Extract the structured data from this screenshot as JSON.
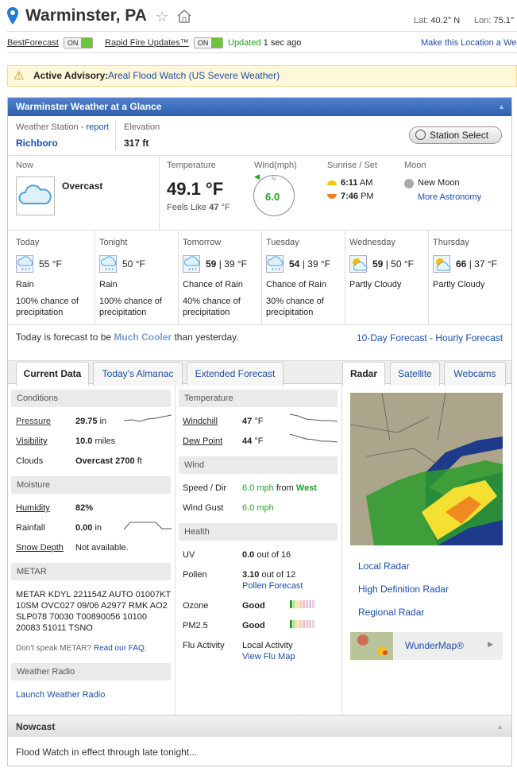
{
  "header": {
    "title": "Warminster, PA",
    "lat_label": "Lat:",
    "lat": "40.2° N",
    "lon_label": "Lon:",
    "lon": "75.1°"
  },
  "toolbar": {
    "bestforecast": "BestForecast",
    "rapidfire": "Rapid Fire Updates™",
    "on": "ON",
    "updated_label": "Updated",
    "updated_val": "1 sec ago",
    "make_location": "Make this Location a Wea"
  },
  "advisory": {
    "label": "Active Advisory:",
    "text": "Areal Flood Watch (US Severe Weather)"
  },
  "glance": {
    "title": "Warminster Weather at a Glance",
    "station_label": "Weather Station -",
    "report": "report",
    "station": "Richboro",
    "elev_label": "Elevation",
    "elev": "317 ft",
    "station_select": "Station Select"
  },
  "now": {
    "label": "Now",
    "condition": "Overcast",
    "temp_label": "Temperature",
    "temp": "49.1 °F",
    "feels_label": "Feels Like",
    "feels": "47",
    "feels_unit": "°F",
    "wind_label": "Wind(mph)",
    "wind": "6.0",
    "wind_n": "N",
    "sun_label": "Sunrise / Set",
    "sunrise": "6:11",
    "am": "AM",
    "sunset": "7:46",
    "pm": "PM",
    "moon_label": "Moon",
    "moon": "New Moon",
    "more_astro": "More Astronomy"
  },
  "forecast": [
    {
      "name": "Today",
      "temp": "55",
      "temp2": "",
      "unit": "°F",
      "cond": "Rain",
      "detail": "100% chance of precipitation"
    },
    {
      "name": "Tonight",
      "temp": "50",
      "temp2": "",
      "unit": "°F",
      "cond": "Rain",
      "detail": "100% chance of precipitation"
    },
    {
      "name": "Tomorrow",
      "temp": "59",
      "temp2": "| 39 °F",
      "unit": "",
      "cond": "Chance of Rain",
      "detail": "40% chance of precipitation"
    },
    {
      "name": "Tuesday",
      "temp": "54",
      "temp2": "| 39 °F",
      "unit": "",
      "cond": "Chance of Rain",
      "detail": "30% chance of precipitation"
    },
    {
      "name": "Wednesday",
      "temp": "59",
      "temp2": "| 50 °F",
      "unit": "",
      "cond": "Partly Cloudy",
      "detail": ""
    },
    {
      "name": "Thursday",
      "temp": "66",
      "temp2": "| 37 °F",
      "unit": "",
      "cond": "Partly Cloudy",
      "detail": ""
    }
  ],
  "cooler": {
    "pre": "Today is forecast to be",
    "mid": "Much Cooler",
    "post": "than yesterday.",
    "ten_day": "10-Day Forecast",
    "dash": "-",
    "hourly": "Hourly Forecast"
  },
  "tabs": [
    "Current Data",
    "Today's Almanac",
    "Extended Forecast"
  ],
  "rtabs": [
    "Radar",
    "Satellite",
    "Webcams"
  ],
  "conditions": {
    "title": "Conditions",
    "pressure_k": "Pressure",
    "pressure_v": "29.75",
    "pressure_u": "in",
    "vis_k": "Visibility",
    "vis_v": "10.0",
    "vis_u": "miles",
    "clouds_k": "Clouds",
    "clouds_v": "Overcast 2700",
    "clouds_u": "ft"
  },
  "moisture": {
    "title": "Moisture",
    "hum_k": "Humidity",
    "hum_v": "82%",
    "rain_k": "Rainfall",
    "rain_v": "0.00",
    "rain_u": "in",
    "snow_k": "Snow Depth",
    "snow_v": "Not available."
  },
  "metar": {
    "title": "METAR",
    "text": "METAR KDYL 221154Z AUTO 01007KT 10SM OVC027 09/06 A2977 RMK AO2 SLP078 70030 T00890056 10100 20083 51011 TSNO",
    "faq_pre": "Don't speak METAR?",
    "faq": "Read our FAQ."
  },
  "radio": {
    "title": "Weather Radio",
    "launch": "Launch Weather Radio"
  },
  "temperature": {
    "title": "Temperature",
    "wc_k": "Windchill",
    "wc_v": "47",
    "wc_u": "°F",
    "dp_k": "Dew Point",
    "dp_v": "44",
    "dp_u": "°F"
  },
  "wind": {
    "title": "Wind",
    "sd_k": "Speed / Dir",
    "sd_v": "6.0",
    "sd_u": "mph",
    "from": "from",
    "dir": "West",
    "gust_k": "Wind Gust",
    "gust_v": "6.0",
    "gust_u": "mph"
  },
  "health": {
    "title": "Health",
    "uv_k": "UV",
    "uv_v": "0.0",
    "uv_u": "out of 16",
    "pollen_k": "Pollen",
    "pollen_v": "3.10",
    "pollen_u": "out of 12",
    "pollen_fc": "Pollen Forecast",
    "ozone_k": "Ozone",
    "ozone_v": "Good",
    "pm_k": "PM2.5",
    "pm_v": "Good",
    "flu_k": "Flu Activity",
    "flu_v": "Local Activity",
    "flu_map": "View Flu Map"
  },
  "radar": {
    "local": "Local Radar",
    "hd": "High Definition Radar",
    "regional": "Regional Radar",
    "wundermap": "WunderMap®"
  },
  "nowcast": {
    "title": "Nowcast",
    "text": "Flood Watch in effect through late tonight..."
  },
  "colors": {
    "accent": "#2b5fae",
    "green": "#22a022"
  }
}
